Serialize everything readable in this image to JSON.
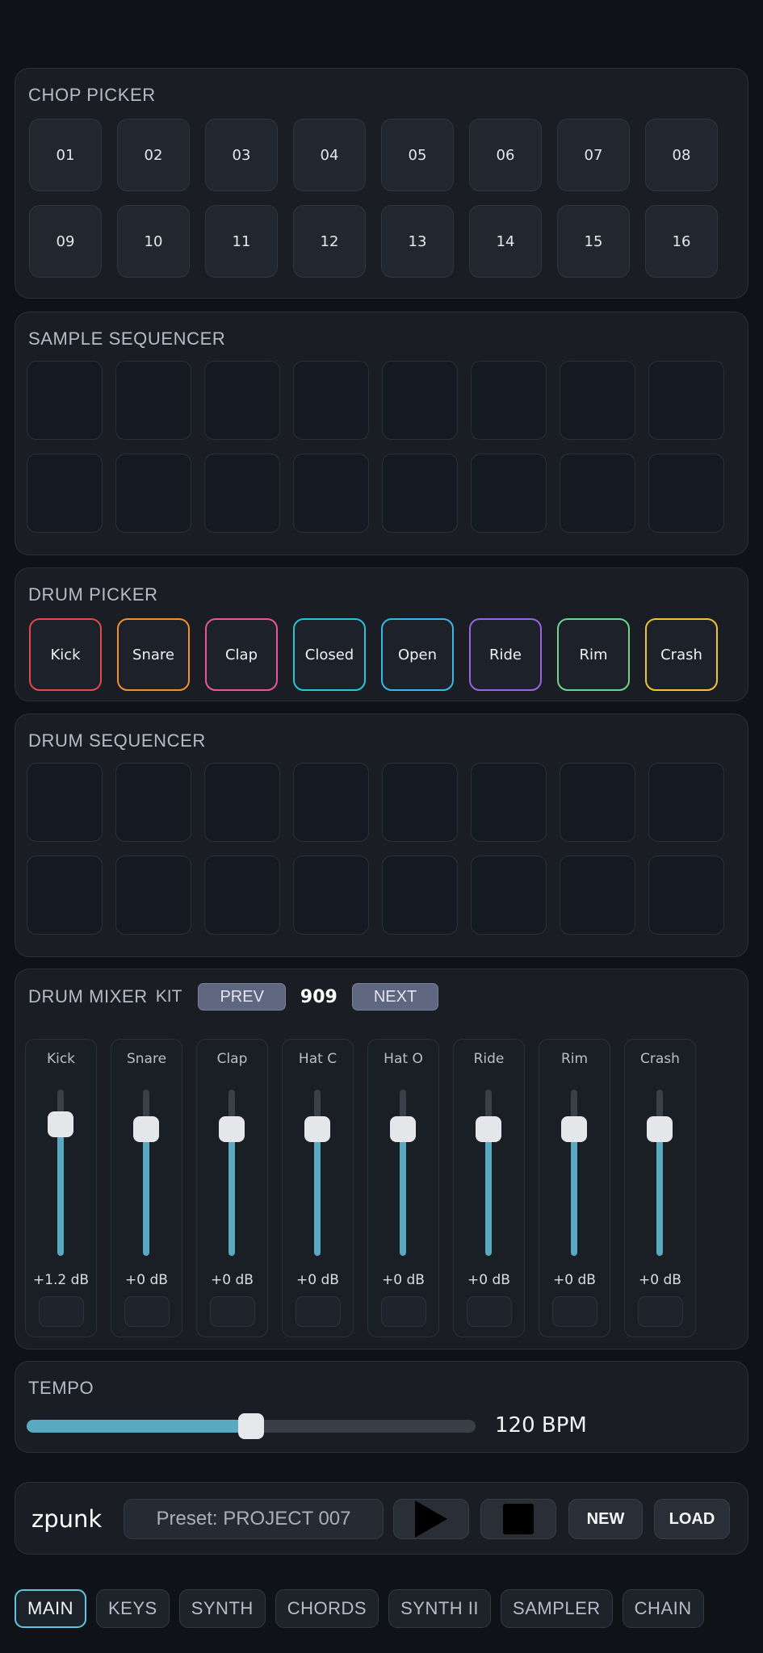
{
  "chop_picker": {
    "title": "CHOP PICKER",
    "pads": [
      "01",
      "02",
      "03",
      "04",
      "05",
      "06",
      "07",
      "08",
      "09",
      "10",
      "11",
      "12",
      "13",
      "14",
      "15",
      "16"
    ]
  },
  "sample_sequencer": {
    "title": "SAMPLE SEQUENCER"
  },
  "drum_picker": {
    "title": "DRUM PICKER",
    "drums": [
      {
        "label": "Kick",
        "color": "#e5484d"
      },
      {
        "label": "Snare",
        "color": "#f0922b"
      },
      {
        "label": "Clap",
        "color": "#e8559a"
      },
      {
        "label": "Closed",
        "color": "#2cc2d8"
      },
      {
        "label": "Open",
        "color": "#3ab7e6"
      },
      {
        "label": "Ride",
        "color": "#9c63e0"
      },
      {
        "label": "Rim",
        "color": "#6fd48c"
      },
      {
        "label": "Crash",
        "color": "#f1c232"
      }
    ]
  },
  "drum_sequencer": {
    "title": "DRUM SEQUENCER"
  },
  "drum_mixer": {
    "title": "DRUM MIXER",
    "kit_label": "KIT",
    "prev_label": "PREV",
    "kit_name": "909",
    "next_label": "NEXT",
    "channels": [
      {
        "label": "Kick",
        "db": "+1.2 dB",
        "level": 0.79
      },
      {
        "label": "Snare",
        "db": "+0 dB",
        "level": 0.76
      },
      {
        "label": "Clap",
        "db": "+0 dB",
        "level": 0.76
      },
      {
        "label": "Hat C",
        "db": "+0 dB",
        "level": 0.76
      },
      {
        "label": "Hat O",
        "db": "+0 dB",
        "level": 0.76
      },
      {
        "label": "Ride",
        "db": "+0 dB",
        "level": 0.76
      },
      {
        "label": "Rim",
        "db": "+0 dB",
        "level": 0.76
      },
      {
        "label": "Crash",
        "db": "+0 dB",
        "level": 0.76
      }
    ]
  },
  "tempo": {
    "title": "TEMPO",
    "value_text": "120 BPM",
    "level": 0.5
  },
  "transport": {
    "brand": "zpunk",
    "preset": "Preset: PROJECT 007",
    "play_icon": "play-icon",
    "stop_icon": "stop-icon",
    "new_label": "NEW",
    "load_label": "LOAD"
  },
  "tabs": [
    {
      "label": "MAIN",
      "active": true
    },
    {
      "label": "KEYS",
      "active": false
    },
    {
      "label": "SYNTH",
      "active": false
    },
    {
      "label": "CHORDS",
      "active": false
    },
    {
      "label": "SYNTH II",
      "active": false
    },
    {
      "label": "SAMPLER",
      "active": false
    },
    {
      "label": "CHAIN",
      "active": false
    }
  ],
  "colors": {
    "accent": "#5aa9c2",
    "tab_active_border": "#5ec6e2"
  }
}
